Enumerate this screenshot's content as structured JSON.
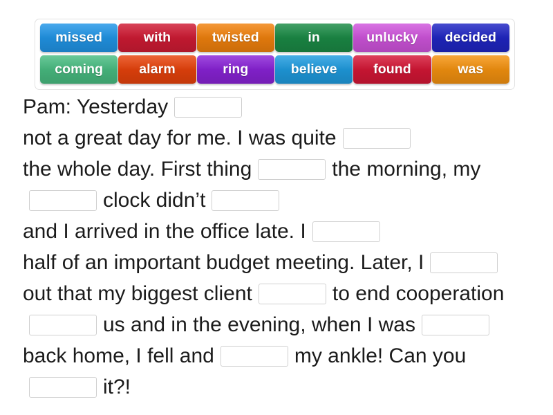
{
  "activity": {
    "type": "drag-and-drop-gap-fill",
    "word_bank": {
      "rows": [
        [
          {
            "label": "missed",
            "color": "#2196e8"
          },
          {
            "label": "with",
            "color": "#d01b34"
          },
          {
            "label": "twisted",
            "color": "#f2820d"
          },
          {
            "label": "in",
            "color": "#1b8b46"
          },
          {
            "label": "unlucky",
            "color": "#d055dd"
          },
          {
            "label": "decided",
            "color": "#2026c4"
          }
        ],
        [
          {
            "label": "coming",
            "color": "#49bd82"
          },
          {
            "label": "alarm",
            "color": "#e8430c"
          },
          {
            "label": "ring",
            "color": "#8a23d8"
          },
          {
            "label": "believe",
            "color": "#1f9ce0"
          },
          {
            "label": "found",
            "color": "#d51736"
          },
          {
            "label": "was",
            "color": "#f5930f"
          }
        ]
      ]
    },
    "text_segments": [
      {
        "kind": "text",
        "value": "Pam: Yesterday"
      },
      {
        "kind": "gap"
      },
      {
        "kind": "text",
        "value": "not a great day for me. I was quite"
      },
      {
        "kind": "gap"
      },
      {
        "kind": "text",
        "value": "the whole day. First thing"
      },
      {
        "kind": "gap"
      },
      {
        "kind": "text",
        "value": "the morning, my"
      },
      {
        "kind": "gap"
      },
      {
        "kind": "text",
        "value": "clock didn’t"
      },
      {
        "kind": "gap"
      },
      {
        "kind": "text",
        "value": "and I arrived in the office late. I"
      },
      {
        "kind": "gap"
      },
      {
        "kind": "text",
        "value": "half of an important budget meeting. Later, I"
      },
      {
        "kind": "gap"
      },
      {
        "kind": "text",
        "value": "out that my biggest client"
      },
      {
        "kind": "gap"
      },
      {
        "kind": "text",
        "value": "to end cooperation"
      },
      {
        "kind": "gap"
      },
      {
        "kind": "text",
        "value": "us and in the evening, when I was"
      },
      {
        "kind": "gap"
      },
      {
        "kind": "text",
        "value": "back home, I fell and"
      },
      {
        "kind": "gap"
      },
      {
        "kind": "text",
        "value": "my ankle! Can you"
      },
      {
        "kind": "gap"
      },
      {
        "kind": "text",
        "value": "it?!"
      }
    ]
  }
}
